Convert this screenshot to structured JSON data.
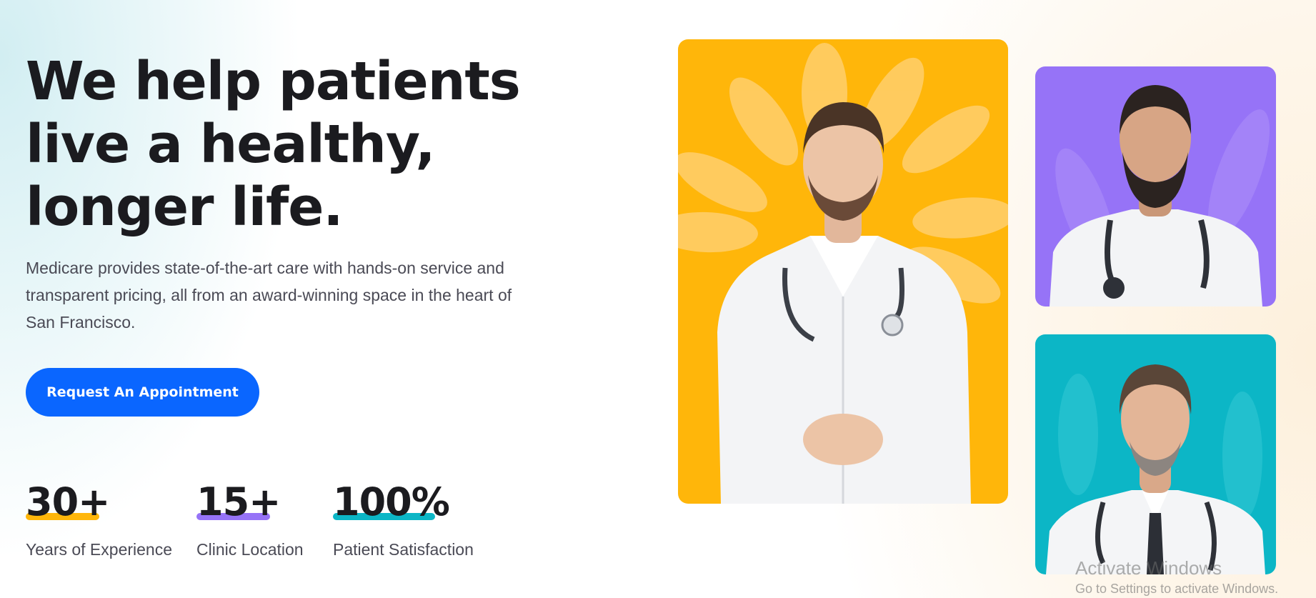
{
  "hero": {
    "title_lines": [
      "We help patients",
      "live a healthy,",
      "longer life."
    ],
    "description": "Medicare provides state-of-the-art care with hands-on service and transparent pricing, all from an award-winning space in the heart of San Francisco.",
    "cta_label": "Request An Appointment"
  },
  "stats": [
    {
      "value": "30+",
      "label": "Years of Experience",
      "accent": "#ffb60a"
    },
    {
      "value": "15+",
      "label": "Clinic Location",
      "accent": "#9673f7"
    },
    {
      "value": "100%",
      "label": "Patient Satisfaction",
      "accent": "#0cb6c6"
    }
  ],
  "gallery": [
    {
      "name": "doctor-photo-main",
      "background": "#ffb60a"
    },
    {
      "name": "doctor-photo-top-right",
      "background": "#9673f7"
    },
    {
      "name": "doctor-photo-bottom-right",
      "background": "#0cb6c6"
    }
  ],
  "windows_watermark": {
    "title": "Activate Windows",
    "subtitle": "Go to Settings to activate Windows."
  },
  "colors": {
    "accent_blue": "#0a66ff",
    "heading": "#1b1b1f",
    "body_text": "#4a4a55"
  }
}
